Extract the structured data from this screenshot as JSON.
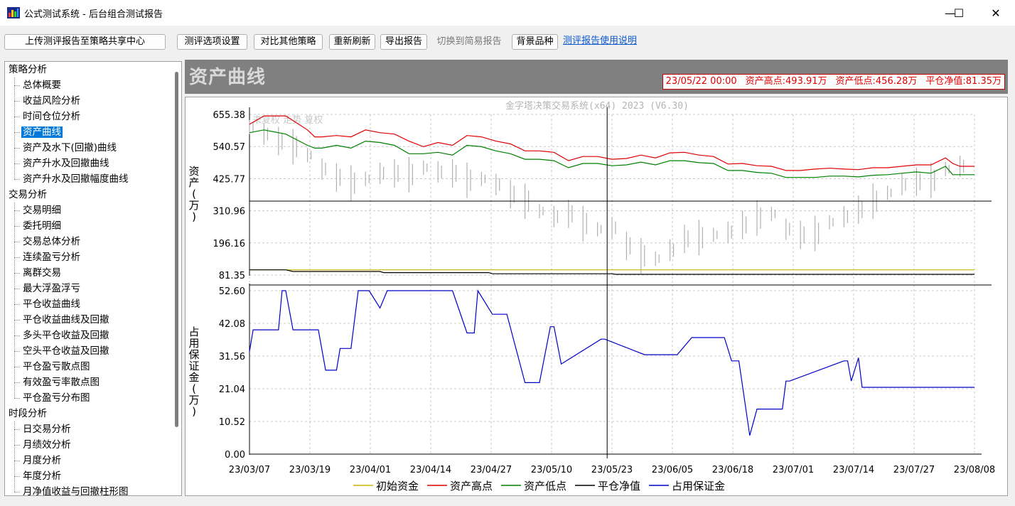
{
  "window": {
    "title": "公式测试系统 - 后台组合测试报告",
    "minimize_glyph": "—",
    "maximize_glyph": "☐",
    "close_glyph": "✕",
    "app_icon": "chart-app-icon"
  },
  "toolbar": {
    "upload_label": "上传测评报告至策略共享中心",
    "options_label": "测评选项设置",
    "compare_label": "对比其他策略",
    "refresh_label": "重新刷新",
    "export_label": "导出报告",
    "switch_label": "切换到简易报告",
    "background_label": "背景品种",
    "help_link": "测评报告使用说明"
  },
  "sidebar": {
    "groups": [
      {
        "label": "策略分析",
        "items": [
          "总体概要",
          "收益风险分析",
          "时间仓位分析",
          "资产曲线",
          "资产及水下(回撤)曲线",
          "资产升水及回撤曲线",
          "资产升水及回撤幅度曲线"
        ]
      },
      {
        "label": "交易分析",
        "items": [
          "交易明细",
          "委托明细",
          "交易总体分析",
          "连续盈亏分析",
          "离群交易",
          "最大浮盈浮亏",
          "平仓收益曲线",
          "平仓收益曲线及回撤",
          "多头平仓收益及回撤",
          "空头平仓收益及回撤",
          "平仓盈亏散点图",
          "有效盈亏率散点图",
          "平仓盈亏分布图"
        ]
      },
      {
        "label": "时段分析",
        "items": [
          "日交易分析",
          "月绩效分析",
          "月度分析",
          "年度分析",
          "月净值收益与回撤柱形图"
        ]
      }
    ],
    "selected": "资产曲线"
  },
  "header": {
    "title": "资产曲线",
    "stats": {
      "datetime": "23/05/22 00:00",
      "high": "资产高点:493.91万",
      "low": "资产低点:456.28万",
      "net": "平仓净值:81.35万"
    }
  },
  "chart_data": {
    "type": "line",
    "watermark": "金字塔决策交易系统(x64) 2023 (V6.30)",
    "background_note": "未复权 走势 复权",
    "x_ticks": [
      "23/03/07",
      "23/03/19",
      "23/04/01",
      "23/04/14",
      "23/04/27",
      "23/05/10",
      "23/05/23",
      "23/06/05",
      "23/06/18",
      "23/07/01",
      "23/07/14",
      "23/07/27",
      "23/08/08"
    ],
    "crosshair_date": "23/05/22",
    "grid": true,
    "legend_position": "bottom",
    "top_panel": {
      "ylabel": "资产(万)",
      "y_ticks": [
        "655.38",
        "540.57",
        "425.77",
        "310.96",
        "196.16",
        "81.35"
      ],
      "ylim": [
        81.35,
        655.38
      ],
      "series": [
        {
          "name": "初始资金",
          "color": "#c8b400",
          "x": [
            0,
            100
          ],
          "values": [
            100,
            100
          ]
        },
        {
          "name": "资产高点",
          "color": "#e00000",
          "x": [
            0,
            2,
            5,
            8,
            9,
            10,
            12,
            14,
            16,
            18,
            20,
            22,
            24,
            26,
            28,
            30,
            32,
            34,
            36,
            38,
            40,
            42,
            44,
            46,
            48,
            50,
            52,
            54,
            56,
            58,
            60,
            62,
            64,
            66,
            68,
            70,
            72,
            74,
            76,
            78,
            80,
            82,
            84,
            86,
            88,
            90,
            92,
            94,
            96,
            97,
            98,
            100
          ],
          "values": [
            620,
            650,
            650,
            600,
            575,
            575,
            580,
            575,
            600,
            590,
            585,
            560,
            540,
            555,
            545,
            580,
            575,
            560,
            550,
            525,
            525,
            520,
            490,
            505,
            505,
            495,
            498,
            510,
            500,
            518,
            520,
            510,
            505,
            478,
            480,
            472,
            470,
            455,
            455,
            460,
            463,
            460,
            458,
            465,
            465,
            470,
            475,
            475,
            500,
            480,
            470,
            470
          ]
        },
        {
          "name": "资产低点",
          "color": "#008000",
          "x": [
            0,
            2,
            5,
            8,
            9,
            10,
            12,
            14,
            16,
            18,
            20,
            22,
            24,
            26,
            28,
            30,
            32,
            34,
            36,
            38,
            40,
            42,
            44,
            46,
            48,
            50,
            52,
            54,
            56,
            58,
            60,
            62,
            64,
            66,
            68,
            70,
            72,
            74,
            76,
            78,
            80,
            82,
            84,
            86,
            88,
            90,
            92,
            94,
            96,
            97,
            98,
            100
          ],
          "values": [
            590,
            600,
            585,
            545,
            535,
            535,
            545,
            535,
            560,
            555,
            545,
            515,
            515,
            520,
            510,
            545,
            540,
            525,
            515,
            495,
            495,
            490,
            465,
            480,
            480,
            472,
            475,
            485,
            475,
            490,
            490,
            483,
            480,
            455,
            455,
            448,
            445,
            430,
            430,
            430,
            435,
            435,
            432,
            438,
            440,
            445,
            450,
            445,
            470,
            440,
            440,
            440
          ]
        },
        {
          "name": "平仓净值",
          "color": "#000000",
          "x": [
            0,
            5,
            6,
            18,
            18.5,
            33,
            33.5,
            50,
            50.5,
            100
          ],
          "values": [
            100,
            100,
            94,
            94,
            90,
            90,
            86,
            86,
            84,
            84
          ]
        },
        {
          "name": "背景品种",
          "color": "#b0b0b0",
          "style": "candles",
          "x": [
            0,
            2,
            4,
            6,
            8,
            10,
            12,
            14,
            16,
            18,
            20,
            22,
            24,
            26,
            28,
            30,
            32,
            34,
            36,
            38,
            40,
            42,
            44,
            46,
            48,
            50,
            52,
            54,
            56,
            58,
            60,
            62,
            64,
            66,
            68,
            70,
            72,
            74,
            76,
            78,
            80,
            82,
            84,
            86,
            88,
            90,
            92,
            94,
            96,
            98
          ],
          "values": [
            610,
            585,
            560,
            540,
            510,
            460,
            430,
            410,
            425,
            445,
            445,
            440,
            465,
            450,
            445,
            420,
            425,
            405,
            370,
            345,
            310,
            290,
            300,
            265,
            245,
            250,
            185,
            150,
            140,
            170,
            210,
            215,
            225,
            235,
            260,
            285,
            300,
            245,
            225,
            230,
            270,
            290,
            315,
            345,
            375,
            405,
            415,
            420,
            460,
            470
          ]
        }
      ]
    },
    "bottom_panel": {
      "ylabel": "占用保证金(万)",
      "y_ticks": [
        "52.60",
        "42.08",
        "31.56",
        "21.04",
        "10.52",
        "0.00"
      ],
      "ylim": [
        0,
        52.6
      ],
      "series": [
        {
          "name": "占用保证金",
          "color": "#0000c8",
          "x": [
            0,
            0.5,
            4,
            4.5,
            5,
            6,
            9.5,
            10.5,
            12,
            12.5,
            14,
            15,
            16.5,
            18,
            19,
            28,
            30,
            31,
            31.5,
            33.5,
            35.5,
            38,
            40,
            41.5,
            42,
            43,
            48.5,
            49,
            54.5,
            59,
            61,
            65.5,
            66.5,
            67.5,
            69,
            70,
            73.5,
            74,
            74.5,
            82,
            82.5,
            83,
            84,
            84.5,
            85.5,
            100
          ],
          "values": [
            33,
            40,
            40,
            52.6,
            52.6,
            40,
            40,
            27,
            27,
            34,
            34,
            52.6,
            52.6,
            47,
            52.6,
            52.6,
            39,
            39,
            52.6,
            45,
            45,
            23,
            23,
            41,
            41,
            29,
            37,
            37,
            32,
            32,
            37.5,
            37.5,
            30,
            30,
            6,
            14.5,
            14.5,
            23.5,
            23.5,
            30,
            30,
            23.5,
            31,
            21.5,
            21.5,
            21.5
          ]
        }
      ]
    },
    "legend": [
      {
        "name": "初始资金",
        "color": "#c8b400"
      },
      {
        "name": "资产高点",
        "color": "#e00000"
      },
      {
        "name": "资产低点",
        "color": "#008000"
      },
      {
        "name": "平仓净值",
        "color": "#000000"
      },
      {
        "name": "占用保证金",
        "color": "#0000c8"
      }
    ]
  }
}
